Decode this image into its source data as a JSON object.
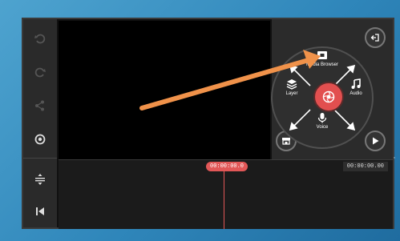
{
  "timeline": {
    "current_time": "00:00:00.0",
    "total_time": "00:00:00.00"
  },
  "media_wheel": {
    "media_browser_label": "Media Browser",
    "layer_label": "Layer",
    "audio_label": "Audio",
    "voice_label": "Voice"
  },
  "left_toolbar": {
    "items": [
      "undo-icon",
      "redo-icon",
      "share-icon",
      "settings-icon",
      "timeline-adjust-icon",
      "skip-to-start-icon"
    ]
  },
  "right_panel": {
    "icons": [
      "exit-icon",
      "store-icon",
      "play-icon"
    ]
  },
  "colors": {
    "accent": "#e25757",
    "annotation_arrow": "#f0924a",
    "background": "#2f86ba"
  }
}
